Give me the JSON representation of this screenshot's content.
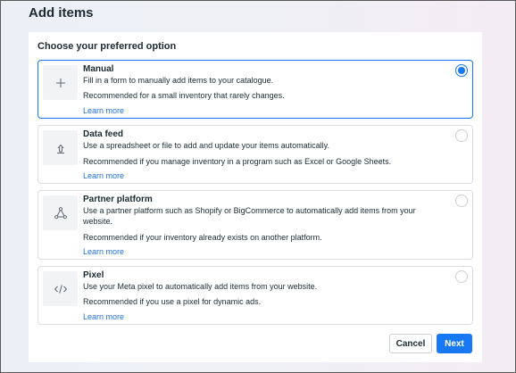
{
  "header": {
    "title": "Add items"
  },
  "section": {
    "title": "Choose your preferred option"
  },
  "options": [
    {
      "icon": "plus-icon",
      "title": "Manual",
      "description": "Fill in a form to manually add items to your catalogue.",
      "recommendation": "Recommended for a small inventory that rarely changes.",
      "link": "Learn more",
      "selected": true
    },
    {
      "icon": "upload-icon",
      "title": "Data feed",
      "description": "Use a spreadsheet or file to add and update your items automatically.",
      "recommendation": "Recommended if you manage inventory in a program such as Excel or Google Sheets.",
      "link": "Learn more",
      "selected": false
    },
    {
      "icon": "network-icon",
      "title": "Partner platform",
      "description": "Use a partner platform such as Shopify or BigCommerce to automatically add items from your website.",
      "recommendation": "Recommended if your inventory already exists on another platform.",
      "link": "Learn more",
      "selected": false
    },
    {
      "icon": "code-icon",
      "title": "Pixel",
      "description": "Use your Meta pixel to automatically add items from your website.",
      "recommendation": "Recommended if you use a pixel for dynamic ads.",
      "link": "Learn more",
      "selected": false
    }
  ],
  "footer": {
    "cancel_label": "Cancel",
    "next_label": "Next"
  },
  "colors": {
    "accent": "#1877f2",
    "link": "#216fdb",
    "text": "#1c2b33",
    "border": "#dadde1"
  }
}
